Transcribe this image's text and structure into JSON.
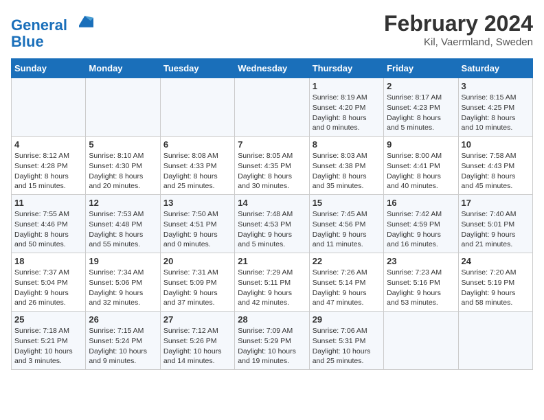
{
  "header": {
    "logo_line1": "General",
    "logo_line2": "Blue",
    "main_title": "February 2024",
    "subtitle": "Kil, Vaermland, Sweden"
  },
  "days_of_week": [
    "Sunday",
    "Monday",
    "Tuesday",
    "Wednesday",
    "Thursday",
    "Friday",
    "Saturday"
  ],
  "weeks": [
    [
      {
        "day": "",
        "info": ""
      },
      {
        "day": "",
        "info": ""
      },
      {
        "day": "",
        "info": ""
      },
      {
        "day": "",
        "info": ""
      },
      {
        "day": "1",
        "info": "Sunrise: 8:19 AM\nSunset: 4:20 PM\nDaylight: 8 hours\nand 0 minutes."
      },
      {
        "day": "2",
        "info": "Sunrise: 8:17 AM\nSunset: 4:23 PM\nDaylight: 8 hours\nand 5 minutes."
      },
      {
        "day": "3",
        "info": "Sunrise: 8:15 AM\nSunset: 4:25 PM\nDaylight: 8 hours\nand 10 minutes."
      }
    ],
    [
      {
        "day": "4",
        "info": "Sunrise: 8:12 AM\nSunset: 4:28 PM\nDaylight: 8 hours\nand 15 minutes."
      },
      {
        "day": "5",
        "info": "Sunrise: 8:10 AM\nSunset: 4:30 PM\nDaylight: 8 hours\nand 20 minutes."
      },
      {
        "day": "6",
        "info": "Sunrise: 8:08 AM\nSunset: 4:33 PM\nDaylight: 8 hours\nand 25 minutes."
      },
      {
        "day": "7",
        "info": "Sunrise: 8:05 AM\nSunset: 4:35 PM\nDaylight: 8 hours\nand 30 minutes."
      },
      {
        "day": "8",
        "info": "Sunrise: 8:03 AM\nSunset: 4:38 PM\nDaylight: 8 hours\nand 35 minutes."
      },
      {
        "day": "9",
        "info": "Sunrise: 8:00 AM\nSunset: 4:41 PM\nDaylight: 8 hours\nand 40 minutes."
      },
      {
        "day": "10",
        "info": "Sunrise: 7:58 AM\nSunset: 4:43 PM\nDaylight: 8 hours\nand 45 minutes."
      }
    ],
    [
      {
        "day": "11",
        "info": "Sunrise: 7:55 AM\nSunset: 4:46 PM\nDaylight: 8 hours\nand 50 minutes."
      },
      {
        "day": "12",
        "info": "Sunrise: 7:53 AM\nSunset: 4:48 PM\nDaylight: 8 hours\nand 55 minutes."
      },
      {
        "day": "13",
        "info": "Sunrise: 7:50 AM\nSunset: 4:51 PM\nDaylight: 9 hours\nand 0 minutes."
      },
      {
        "day": "14",
        "info": "Sunrise: 7:48 AM\nSunset: 4:53 PM\nDaylight: 9 hours\nand 5 minutes."
      },
      {
        "day": "15",
        "info": "Sunrise: 7:45 AM\nSunset: 4:56 PM\nDaylight: 9 hours\nand 11 minutes."
      },
      {
        "day": "16",
        "info": "Sunrise: 7:42 AM\nSunset: 4:59 PM\nDaylight: 9 hours\nand 16 minutes."
      },
      {
        "day": "17",
        "info": "Sunrise: 7:40 AM\nSunset: 5:01 PM\nDaylight: 9 hours\nand 21 minutes."
      }
    ],
    [
      {
        "day": "18",
        "info": "Sunrise: 7:37 AM\nSunset: 5:04 PM\nDaylight: 9 hours\nand 26 minutes."
      },
      {
        "day": "19",
        "info": "Sunrise: 7:34 AM\nSunset: 5:06 PM\nDaylight: 9 hours\nand 32 minutes."
      },
      {
        "day": "20",
        "info": "Sunrise: 7:31 AM\nSunset: 5:09 PM\nDaylight: 9 hours\nand 37 minutes."
      },
      {
        "day": "21",
        "info": "Sunrise: 7:29 AM\nSunset: 5:11 PM\nDaylight: 9 hours\nand 42 minutes."
      },
      {
        "day": "22",
        "info": "Sunrise: 7:26 AM\nSunset: 5:14 PM\nDaylight: 9 hours\nand 47 minutes."
      },
      {
        "day": "23",
        "info": "Sunrise: 7:23 AM\nSunset: 5:16 PM\nDaylight: 9 hours\nand 53 minutes."
      },
      {
        "day": "24",
        "info": "Sunrise: 7:20 AM\nSunset: 5:19 PM\nDaylight: 9 hours\nand 58 minutes."
      }
    ],
    [
      {
        "day": "25",
        "info": "Sunrise: 7:18 AM\nSunset: 5:21 PM\nDaylight: 10 hours\nand 3 minutes."
      },
      {
        "day": "26",
        "info": "Sunrise: 7:15 AM\nSunset: 5:24 PM\nDaylight: 10 hours\nand 9 minutes."
      },
      {
        "day": "27",
        "info": "Sunrise: 7:12 AM\nSunset: 5:26 PM\nDaylight: 10 hours\nand 14 minutes."
      },
      {
        "day": "28",
        "info": "Sunrise: 7:09 AM\nSunset: 5:29 PM\nDaylight: 10 hours\nand 19 minutes."
      },
      {
        "day": "29",
        "info": "Sunrise: 7:06 AM\nSunset: 5:31 PM\nDaylight: 10 hours\nand 25 minutes."
      },
      {
        "day": "",
        "info": ""
      },
      {
        "day": "",
        "info": ""
      }
    ]
  ]
}
